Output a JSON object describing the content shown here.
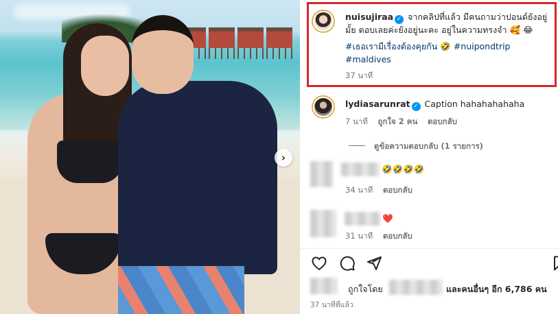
{
  "post": {
    "owner_username": "nuisujiraa",
    "caption_line1": "จากคลิปที่แล้ว มีคนถามว่าปอนด์ยังอยู่",
    "caption_line2": "มั้ย ตอบเลยค่ะยังอยู่นะคะ อยู่ในความทรงจำ 🥰 😂",
    "hashtag1": "#เธอเรามีเรื่องต้องคุยกัน",
    "hashtag2_emoji": "🤣",
    "hashtag2": "#nuipondtrip",
    "hashtag3": "#maldives",
    "time": "37 นาที"
  },
  "comments": [
    {
      "username": "lydiasarunrat",
      "text": "Caption hahahahahaha",
      "time": "7 นาที",
      "likes": "ถูกใจ 2 คน",
      "reply": "ตอบกลับ",
      "view_replies": "ดูข้อความตอบกลับ (1 รายการ)"
    },
    {
      "username": "",
      "text": "🤣🤣🤣🤣",
      "time": "34 นาที",
      "reply": "ตอบกลับ"
    },
    {
      "username": "",
      "text": "❤️",
      "time": "31 นาที",
      "reply": "ตอบกลับ"
    }
  ],
  "actions": {
    "like_icon": "heart-icon",
    "comment_icon": "comment-icon",
    "share_icon": "send-icon",
    "save_icon": "bookmark-icon"
  },
  "likes_line": {
    "prefix": "ถูกใจโดย",
    "suffix": "และคนอื่นๆ อีก 6,786 คน"
  },
  "footer_time": "37 นาทีที่แล้ว",
  "colors": {
    "highlight_border": "#d9262c",
    "link": "#00376b",
    "verified": "#0095f6",
    "muted": "#737373"
  }
}
